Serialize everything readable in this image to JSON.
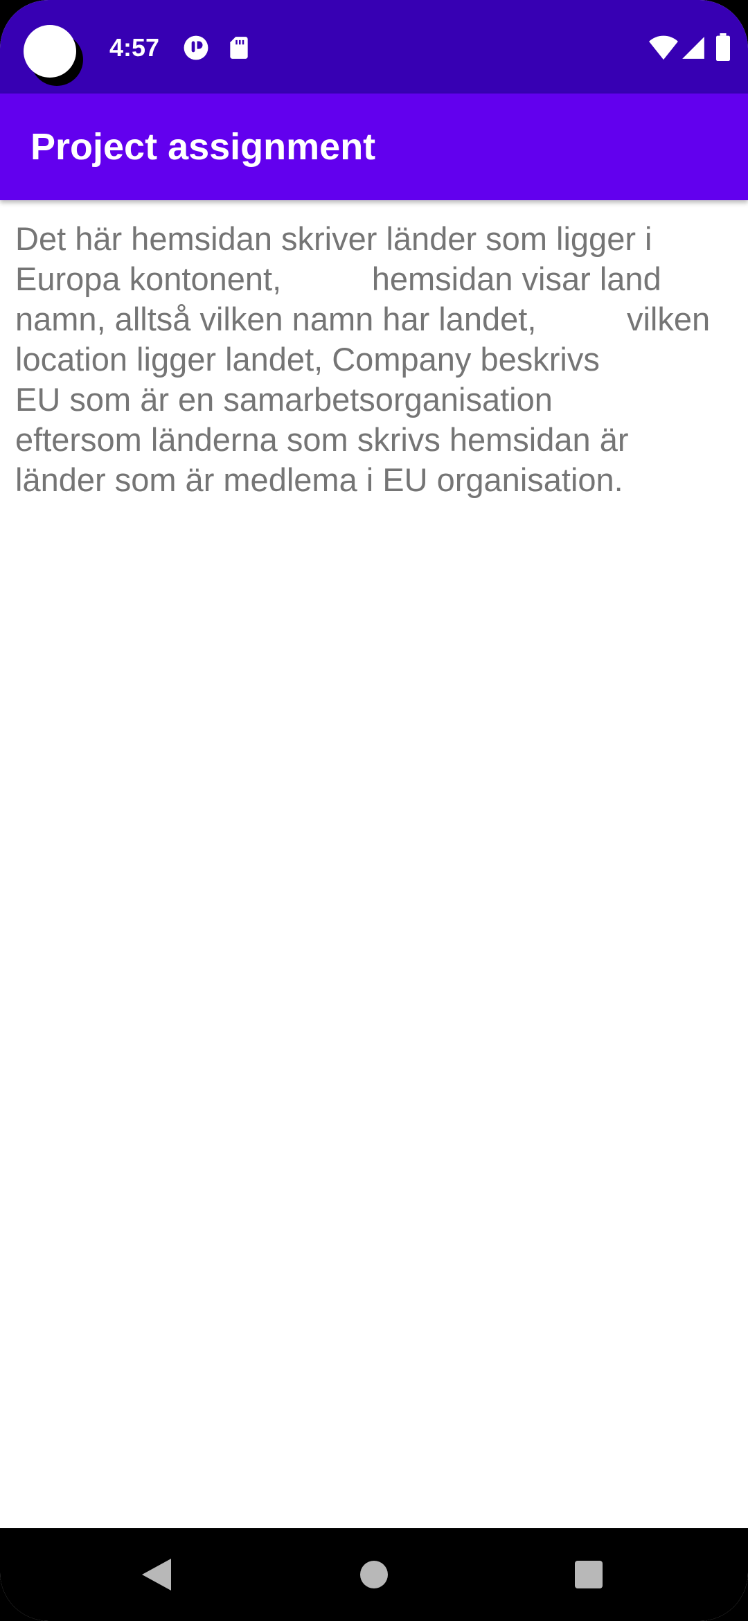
{
  "status_bar": {
    "time": "4:57",
    "icons": {
      "left": [
        "notification-app-icon",
        "sd-card-icon"
      ],
      "right": [
        "wifi-icon",
        "cellular-signal-icon",
        "battery-icon"
      ]
    }
  },
  "app_bar": {
    "title": "Project assignment"
  },
  "content": {
    "text": "Det här hemsidan skriver länder som ligger i\nEuropa kontonent,          hemsidan visar land\nnamn, alltså vilken namn har landet,          vilken\nlocation ligger landet, Company beskrivs\nEU som är en samarbetsorganisation\neftersom länderna som skrivs hemsidan är\nländer som är medlema i EU organisation."
  },
  "nav_bar": {
    "buttons": [
      "back",
      "home",
      "recents"
    ]
  },
  "colors": {
    "status_bar": "#3700b3",
    "app_bar": "#6200ee",
    "text": "#757575",
    "background": "#ffffff"
  }
}
